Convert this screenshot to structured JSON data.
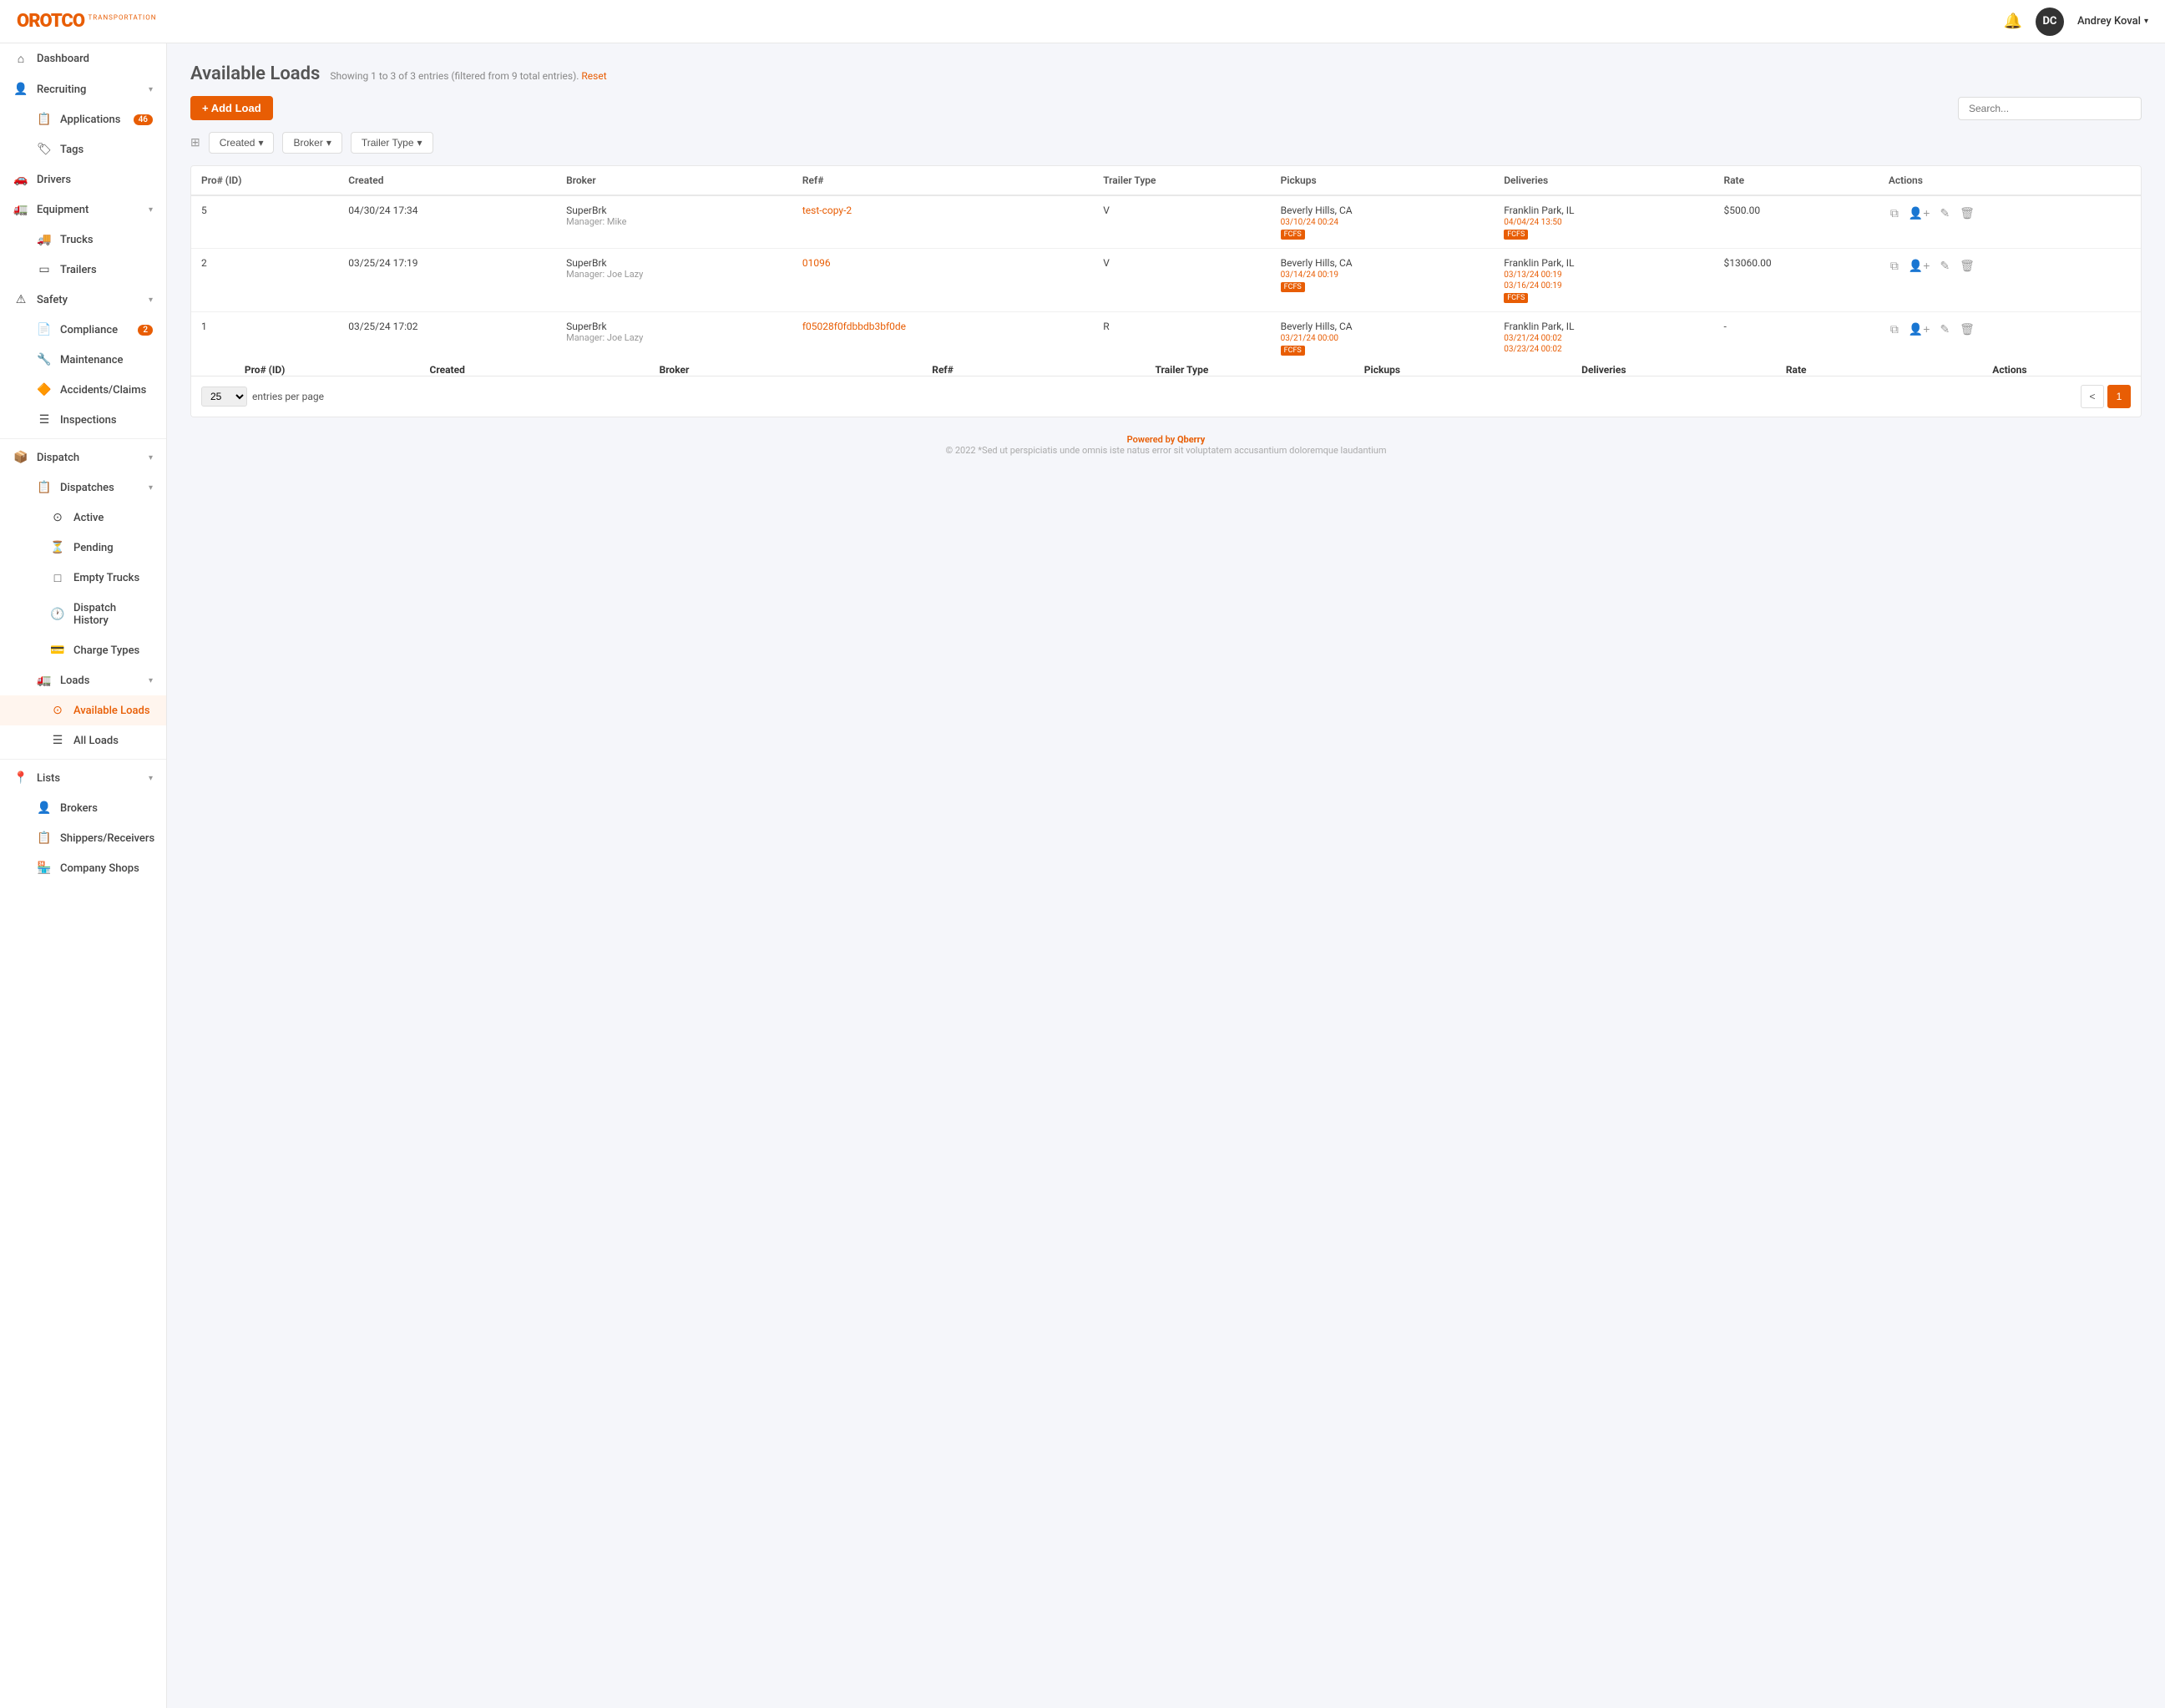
{
  "header": {
    "logo_text": "OROTCO",
    "logo_sub": "TRANSPORTATION",
    "bell_icon": "🔔",
    "user_initials": "DC",
    "user_name": "Andrey Koval",
    "chevron_icon": "▾"
  },
  "sidebar": {
    "items": [
      {
        "id": "dashboard",
        "label": "Dashboard",
        "icon": "⌂",
        "has_arrow": false,
        "badge": null,
        "indent": false
      },
      {
        "id": "recruiting",
        "label": "Recruiting",
        "icon": "👤",
        "has_arrow": true,
        "badge": null,
        "indent": false
      },
      {
        "id": "applications",
        "label": "Applications",
        "icon": "📋",
        "has_arrow": false,
        "badge": "46",
        "indent": true
      },
      {
        "id": "tags",
        "label": "Tags",
        "icon": "🏷",
        "has_arrow": false,
        "badge": null,
        "indent": true
      },
      {
        "id": "drivers",
        "label": "Drivers",
        "icon": "🚗",
        "has_arrow": false,
        "badge": null,
        "indent": false
      },
      {
        "id": "equipment",
        "label": "Equipment",
        "icon": "🚛",
        "has_arrow": true,
        "badge": null,
        "indent": false
      },
      {
        "id": "trucks",
        "label": "Trucks",
        "icon": "🚚",
        "has_arrow": false,
        "badge": null,
        "indent": true
      },
      {
        "id": "trailers",
        "label": "Trailers",
        "icon": "▭",
        "has_arrow": false,
        "badge": null,
        "indent": true
      },
      {
        "id": "safety",
        "label": "Safety",
        "icon": "⚠",
        "has_arrow": true,
        "badge": null,
        "indent": false
      },
      {
        "id": "compliance",
        "label": "Compliance",
        "icon": "📄",
        "has_arrow": false,
        "badge": "2",
        "indent": true
      },
      {
        "id": "maintenance",
        "label": "Maintenance",
        "icon": "🔧",
        "has_arrow": false,
        "badge": null,
        "indent": true
      },
      {
        "id": "accidents",
        "label": "Accidents/Claims",
        "icon": "🔶",
        "has_arrow": false,
        "badge": null,
        "indent": true
      },
      {
        "id": "inspections",
        "label": "Inspections",
        "icon": "☰",
        "has_arrow": false,
        "badge": null,
        "indent": true
      },
      {
        "id": "dispatch",
        "label": "Dispatch",
        "icon": "📦",
        "has_arrow": true,
        "badge": null,
        "indent": false
      },
      {
        "id": "dispatches",
        "label": "Dispatches",
        "icon": "📋",
        "has_arrow": true,
        "badge": null,
        "indent": true
      },
      {
        "id": "active",
        "label": "Active",
        "icon": "⊙",
        "has_arrow": false,
        "badge": null,
        "indent": true,
        "sub": true
      },
      {
        "id": "pending",
        "label": "Pending",
        "icon": "⏳",
        "has_arrow": false,
        "badge": null,
        "indent": true,
        "sub": true
      },
      {
        "id": "empty-trucks",
        "label": "Empty Trucks",
        "icon": "□",
        "has_arrow": false,
        "badge": null,
        "indent": true,
        "sub": true
      },
      {
        "id": "dispatch-history",
        "label": "Dispatch History",
        "icon": "🕐",
        "has_arrow": false,
        "badge": null,
        "indent": true,
        "sub": true
      },
      {
        "id": "charge-types",
        "label": "Charge Types",
        "icon": "💳",
        "has_arrow": false,
        "badge": null,
        "indent": true,
        "sub": true
      },
      {
        "id": "loads",
        "label": "Loads",
        "icon": "🚛",
        "has_arrow": true,
        "badge": null,
        "indent": true
      },
      {
        "id": "available-loads",
        "label": "Available Loads",
        "icon": "⊙",
        "has_arrow": false,
        "badge": null,
        "indent": true,
        "sub": true,
        "active": true
      },
      {
        "id": "all-loads",
        "label": "All Loads",
        "icon": "☰",
        "has_arrow": false,
        "badge": null,
        "indent": true,
        "sub": true
      },
      {
        "id": "lists",
        "label": "Lists",
        "icon": "📍",
        "has_arrow": true,
        "badge": null,
        "indent": false
      },
      {
        "id": "brokers",
        "label": "Brokers",
        "icon": "👤",
        "has_arrow": false,
        "badge": null,
        "indent": true
      },
      {
        "id": "shippers",
        "label": "Shippers/Receivers",
        "icon": "📋",
        "has_arrow": false,
        "badge": null,
        "indent": true
      },
      {
        "id": "company-shops",
        "label": "Company Shops",
        "icon": "🏪",
        "has_arrow": false,
        "badge": null,
        "indent": true
      }
    ]
  },
  "main": {
    "title": "Available Loads",
    "subtitle": "Showing 1 to 3 of 3 entries (filtered from 9 total entries).",
    "reset_label": "Reset",
    "add_button": "+ Add Load",
    "search_placeholder": "Search...",
    "filters": [
      {
        "label": "Created",
        "icon": "▾"
      },
      {
        "label": "Broker",
        "icon": "▾"
      },
      {
        "label": "Trailer Type",
        "icon": "▾"
      }
    ],
    "filter_icon": "⊞",
    "table": {
      "columns": [
        "Pro# (ID)",
        "Created",
        "Broker",
        "Ref#",
        "Trailer Type",
        "Pickups",
        "Deliveries",
        "Rate",
        "Actions"
      ],
      "rows": [
        {
          "pro_id": "5",
          "created": "04/30/24 17:34",
          "broker": "SuperBrk",
          "broker_sub": "Manager: Mike",
          "ref": "test-copy-2",
          "ref_is_link": true,
          "trailer_type": "V",
          "pickup_city": "Beverly Hills, CA",
          "pickup_date": "03/10/24 00:24",
          "pickup_badge": "FCFS",
          "delivery_city": "Franklin Park, IL",
          "delivery_date": "04/04/24 13:50",
          "delivery_badge": "FCFS",
          "rate": "$500.00",
          "has_rate": true
        },
        {
          "pro_id": "2",
          "created": "03/25/24 17:19",
          "broker": "SuperBrk",
          "broker_sub": "Manager: Joe Lazy",
          "ref": "01096",
          "ref_is_link": true,
          "trailer_type": "V",
          "pickup_city": "Beverly Hills, CA",
          "pickup_date": "03/14/24 00:19",
          "pickup_badge": "FCFS",
          "delivery_city": "Franklin Park, IL",
          "delivery_date1": "03/13/24 00:19",
          "delivery_date2": "03/16/24 00:19",
          "delivery_badge": "FCFS",
          "rate": "$13060.00",
          "has_rate": true
        },
        {
          "pro_id": "1",
          "created": "03/25/24 17:02",
          "broker": "SuperBrk",
          "broker_sub": "Manager: Joe Lazy",
          "ref": "f05028f0fdbbdb3bf0de",
          "ref_is_link": true,
          "trailer_type": "R",
          "pickup_city": "Beverly Hills, CA",
          "pickup_date": "03/21/24 00:00",
          "pickup_badge": "FCFS",
          "delivery_city": "Franklin Park, IL",
          "delivery_date1": "03/21/24 00:02",
          "delivery_date2": "03/23/24 00:02",
          "delivery_badge": "",
          "rate": "-",
          "has_rate": false
        }
      ],
      "footer_columns": [
        "Pro# (ID)",
        "Created",
        "Broker",
        "Ref#",
        "Trailer Type",
        "Pickups",
        "Deliveries",
        "Rate",
        "Actions"
      ]
    },
    "entries_per_page": "25",
    "entries_label": "entries per page",
    "pagination": {
      "prev": "<",
      "current": "1"
    }
  },
  "footer": {
    "powered_by": "Powered by",
    "brand": "Qberry",
    "copyright": "© 2022 *Sed ut perspiciatis unde omnis iste natus error sit voluptatem accusantium doloremque laudantium"
  }
}
